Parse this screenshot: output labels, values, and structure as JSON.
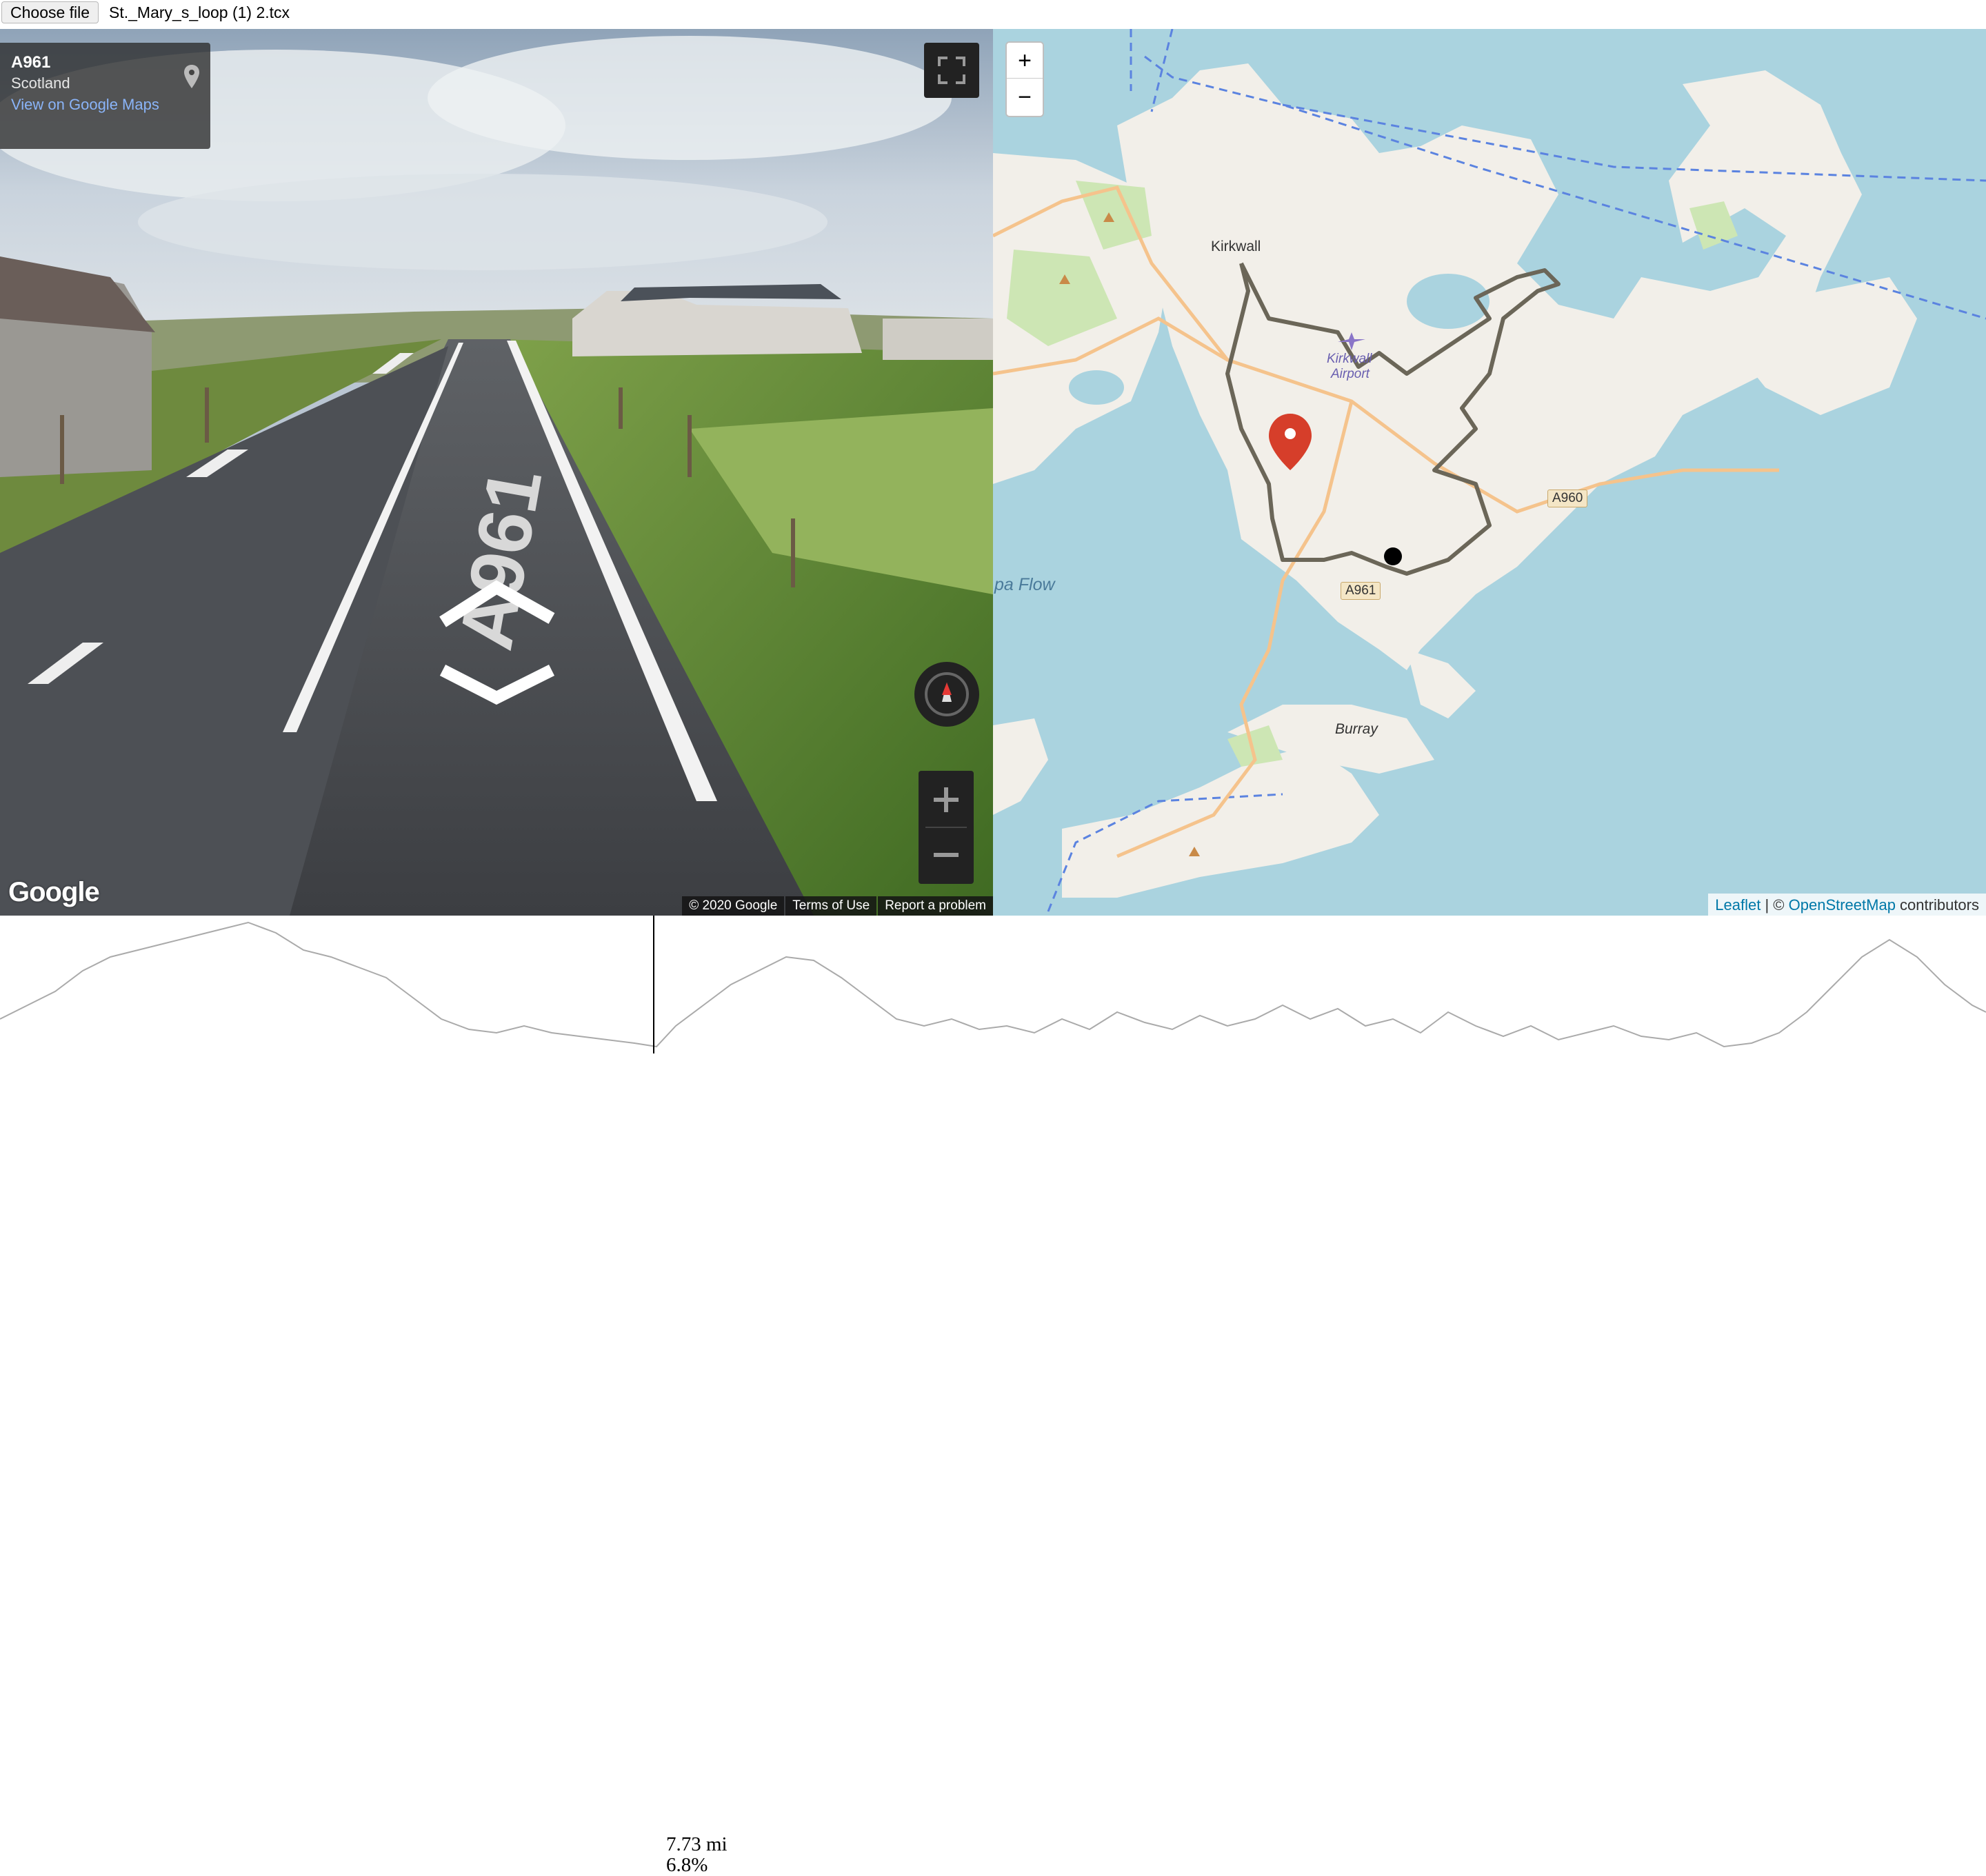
{
  "file_input": {
    "button_label": "Choose file",
    "file_name": "St._Mary_s_loop (1) 2.tcx"
  },
  "streetview": {
    "road": "A961",
    "region": "Scotland",
    "link": "View on Google Maps",
    "road_marking": "A961",
    "logo": "Google",
    "footer": {
      "copyright": "© 2020 Google",
      "terms": "Terms of Use",
      "report": "Report a problem"
    },
    "icons": [
      "pin-icon",
      "fullscreen-icon",
      "compass-icon",
      "plus-icon",
      "minus-icon",
      "chevron-up-icon",
      "chevron-down-icon"
    ]
  },
  "map": {
    "zoom_in": "+",
    "zoom_out": "−",
    "labels": {
      "kirkwall": "Kirkwall",
      "airport_line1": "Kirkwall",
      "airport_line2": "Airport",
      "burray": "Burray",
      "flow": "pa Flow"
    },
    "shields": {
      "a960": "A960",
      "a961": "A961"
    },
    "attribution": {
      "leaflet": "Leaflet",
      "sep": " | © ",
      "osm": "OpenStreetMap",
      "suffix": " contributors"
    },
    "colors": {
      "water": "#aad3df",
      "land": "#f2efe9",
      "route": "#6b6658",
      "marker": "#d63e2a"
    }
  },
  "profile": {
    "distance": "7.73 mi",
    "grade": "6.8%",
    "cursor_fraction": 0.33
  }
}
